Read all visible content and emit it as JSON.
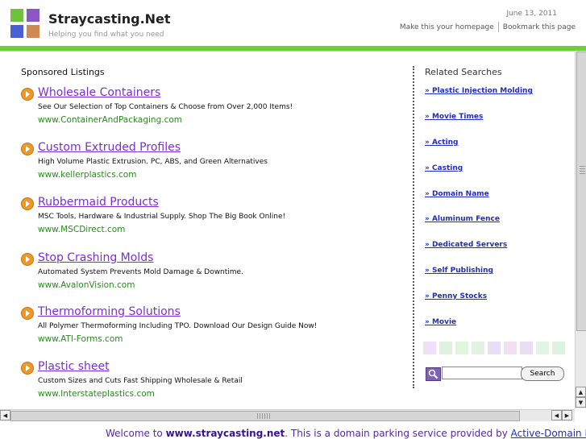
{
  "header": {
    "site_title": "Straycasting.Net",
    "tagline": "Helping you find what you need",
    "date": "June 13, 2011",
    "homepage_link": "Make this your homepage",
    "bookmark_link": "Bookmark this page"
  },
  "sponsored": {
    "title": "Sponsored Listings",
    "listings": [
      {
        "title": "Wholesale Containers",
        "desc": "See Our Selection of Top Containers & Choose from Over 2,000 Items!",
        "url": "www.ContainerAndPackaging.com"
      },
      {
        "title": "Custom Extruded Profiles",
        "desc": "High Volume Plastic Extrusion. PC, ABS, and Green Alternatives",
        "url": "www.kellerplastics.com"
      },
      {
        "title": "Rubbermaid Products",
        "desc": "MSC Tools, Hardware & Industrial Supply. Shop The Big Book Online!",
        "url": "www.MSCDirect.com"
      },
      {
        "title": "Stop Crashing Molds",
        "desc": "Automated System Prevents Mold Damage & Downtime.",
        "url": "www.AvalonVision.com"
      },
      {
        "title": "Thermoforming Solutions",
        "desc": "All Polymer Thermoforming Including TPO. Download Our Design Guide Now!",
        "url": "www.ATI-Forms.com"
      },
      {
        "title": "Plastic sheet",
        "desc": "Custom Sizes and Cuts Fast Shipping Wholesale & Retail",
        "url": "www.Interstateplastics.com"
      }
    ]
  },
  "related": {
    "title": "Related Searches",
    "items": [
      "» Plastic Injection Molding",
      "» Movie Times",
      "» Acting",
      "» Casting",
      "» Domain Name",
      "» Aluminum Fence",
      "» Dedicated Servers",
      "» Self Publishing",
      "» Penny Stocks",
      "» Movie"
    ],
    "swatch_colors": [
      "#efdff7",
      "#dff2e2",
      "#dff7df",
      "#e2f2e2",
      "#eadff7",
      "#f2dff2",
      "#eadff2",
      "#dff7e2",
      "#dff2df"
    ]
  },
  "search": {
    "value": "",
    "button_label": "Search"
  },
  "footer": {
    "prefix": "Welcome to ",
    "domain": "www.straycasting.net",
    "middle": ". This is a domain parking service provided by ",
    "provider": "Active-Domain LLC",
    "suffix": "."
  }
}
